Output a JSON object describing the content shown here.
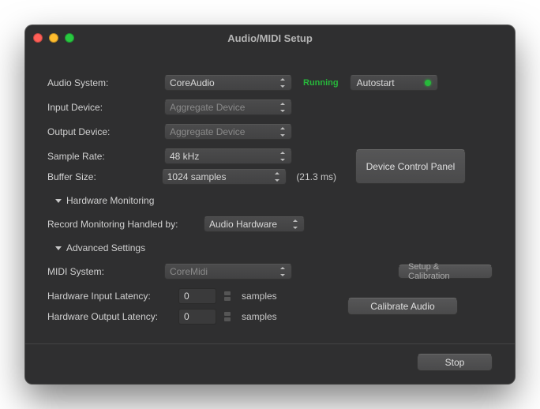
{
  "window": {
    "title": "Audio/MIDI Setup"
  },
  "labels": {
    "audio_system": "Audio System:",
    "input_device": "Input Device:",
    "output_device": "Output Device:",
    "sample_rate": "Sample Rate:",
    "buffer_size": "Buffer Size:",
    "hardware_monitoring": "Hardware Monitoring",
    "record_monitoring": "Record Monitoring Handled by:",
    "advanced_settings": "Advanced Settings",
    "midi_system": "MIDI System:",
    "hw_input_latency": "Hardware Input Latency:",
    "hw_output_latency": "Hardware Output Latency:",
    "samples": "samples",
    "setup_calibration": "Setup & Calibration"
  },
  "values": {
    "audio_system": "CoreAudio",
    "input_device": "Aggregate Device",
    "output_device": "Aggregate Device",
    "sample_rate": "48 kHz",
    "buffer_size": "1024 samples",
    "buffer_ms": "(21.3 ms)",
    "record_monitoring": "Audio Hardware",
    "midi_system": "CoreMidi",
    "hw_input_latency": "0",
    "hw_output_latency": "0"
  },
  "status": {
    "running": "Running",
    "autostart": "Autostart"
  },
  "buttons": {
    "device_control_panel": "Device Control Panel",
    "calibrate_audio": "Calibrate Audio",
    "stop": "Stop"
  }
}
